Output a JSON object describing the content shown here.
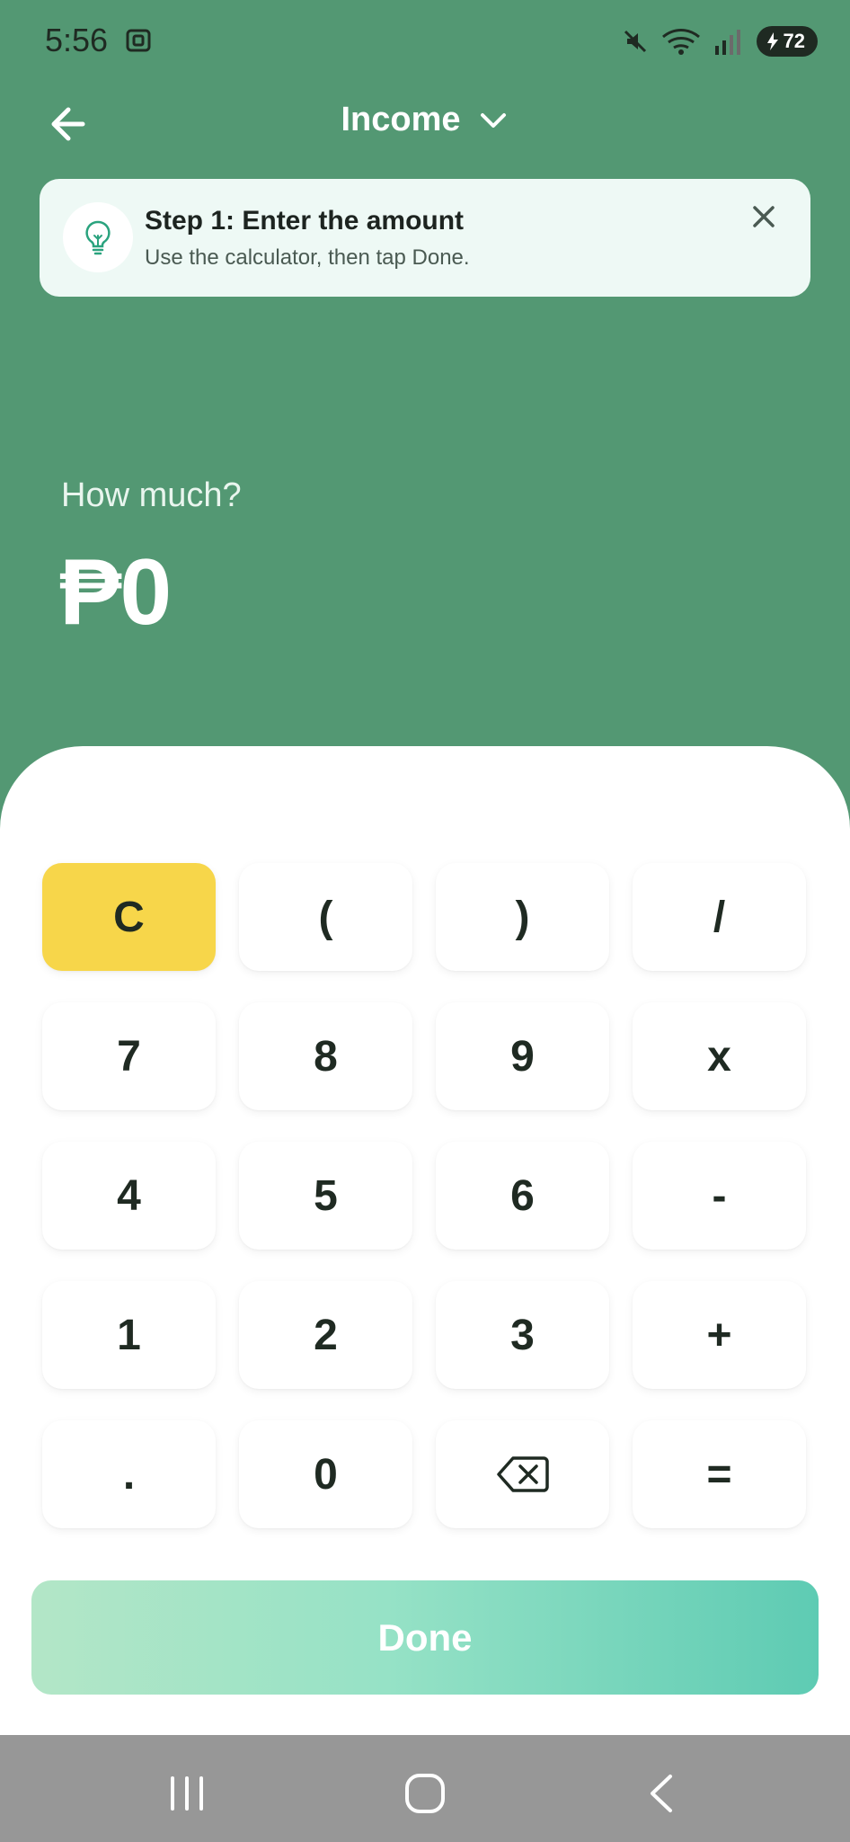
{
  "status": {
    "time": "5:56",
    "battery": "72",
    "icons": [
      "screenshot-icon",
      "mute-icon",
      "wifi-icon",
      "signal-icon",
      "charging-icon"
    ]
  },
  "header": {
    "title": "Income",
    "icons": [
      "back-arrow-icon",
      "chevron-down-icon"
    ]
  },
  "hint": {
    "title": "Step 1: Enter the amount",
    "text": "Use the calculator, then tap Done.",
    "icons": [
      "lightbulb-icon",
      "close-icon"
    ]
  },
  "amount": {
    "prompt": "How much?",
    "value": "₱0"
  },
  "keypad": {
    "keys": [
      "C",
      "(",
      ")",
      "/",
      "7",
      "8",
      "9",
      "x",
      "4",
      "5",
      "6",
      "-",
      "1",
      "2",
      "3",
      "+",
      ".",
      "0",
      "",
      "="
    ],
    "backspace_icon": "backspace-icon"
  },
  "done": {
    "label": "Done"
  },
  "nav": {
    "icons": [
      "recent-apps-icon",
      "home-icon",
      "back-icon"
    ]
  },
  "colors": {
    "background": "#539873",
    "clear_key": "#f7d64a",
    "done_gradient_start": "#b3e6c7",
    "done_gradient_end": "#5ecbb3"
  }
}
